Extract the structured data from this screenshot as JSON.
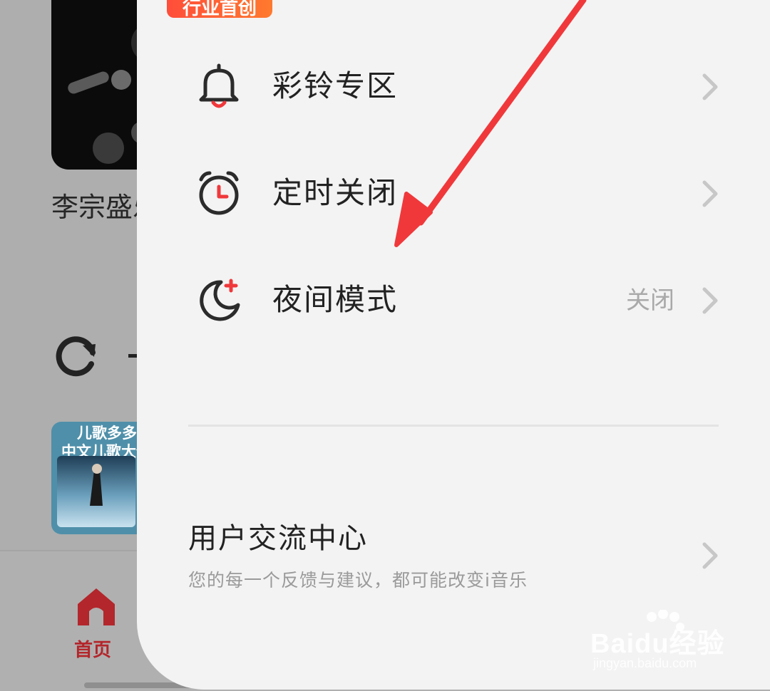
{
  "background": {
    "song_title": "李宗盛乐教父",
    "album_line1": "儿歌多多",
    "album_line2": "中文儿歌大全",
    "nav_home_label": "首页",
    "accent_color": "#b3262b"
  },
  "drawer": {
    "badge": "行业首创",
    "menu": [
      {
        "label": "彩铃专区",
        "icon": "bell-icon",
        "value": ""
      },
      {
        "label": "定时关闭",
        "icon": "alarm-clock-icon",
        "value": ""
      },
      {
        "label": "夜间模式",
        "icon": "moon-icon",
        "value": "关闭"
      }
    ],
    "feedback": {
      "title": "用户交流中心",
      "subtitle": "您的每一个反馈与建议，都可能改变i音乐"
    }
  },
  "watermark": {
    "brand": "Bai",
    "brand_suffix": "du",
    "brand_cn": "经验",
    "url": "jingyan.baidu.com"
  },
  "annotation": {
    "color": "#f0383b"
  }
}
